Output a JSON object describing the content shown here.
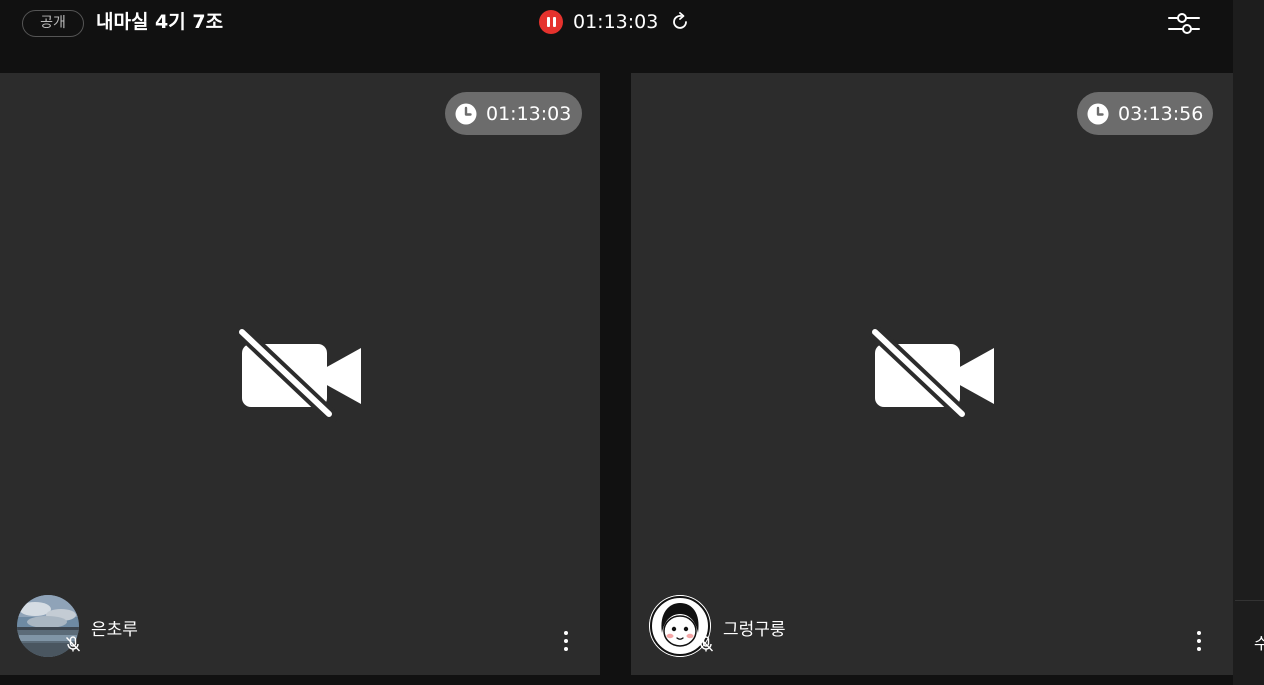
{
  "header": {
    "visibility_badge": "공개",
    "room_title": "내마실 4기 7조",
    "study_timer": "01:13:03",
    "icons": {
      "pause": "pause-icon",
      "refresh": "refresh-icon",
      "settings": "settings-sliders-icon"
    },
    "accent_color": "#e5322d"
  },
  "participants": [
    {
      "name": "은초루",
      "timer": "01:13:03",
      "camera": "off",
      "mic": "off",
      "avatar": "landscape-photo-avatar"
    },
    {
      "name": "그렁구룽",
      "timer": "03:13:56",
      "camera": "off",
      "mic": "off",
      "avatar": "cartoon-face-avatar"
    }
  ],
  "sidebar": {
    "partial_text": "수"
  }
}
